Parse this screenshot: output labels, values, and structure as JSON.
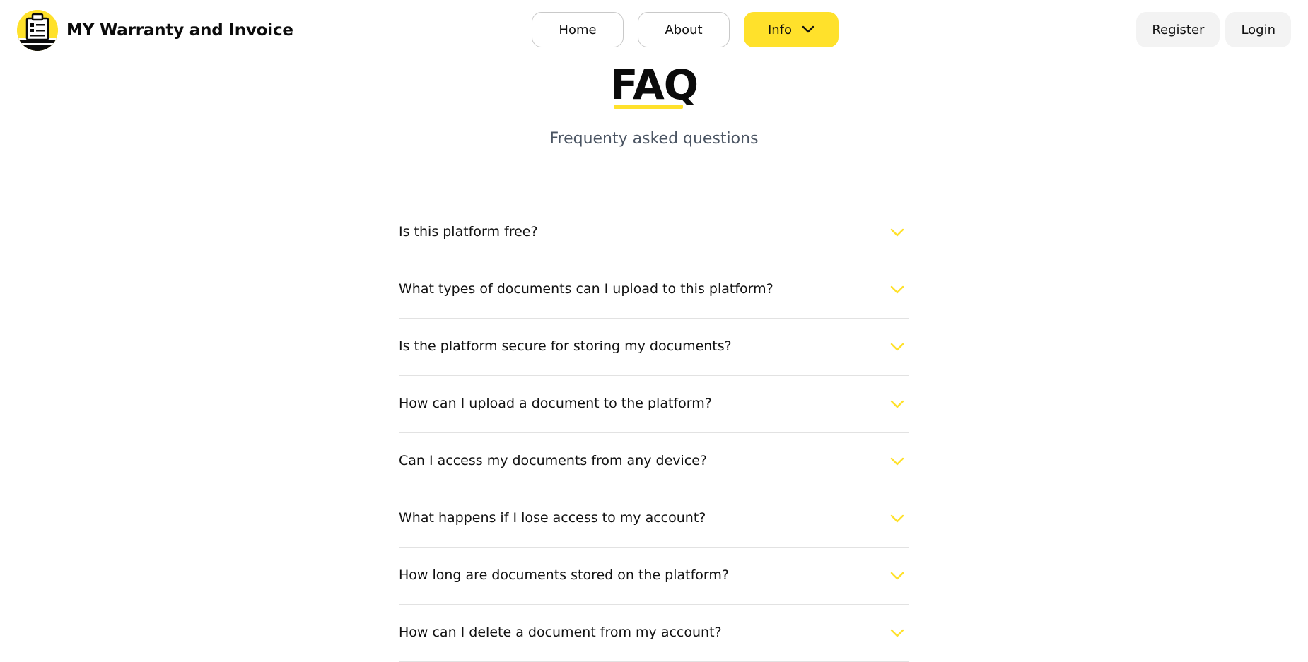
{
  "brand": {
    "name": "MY Warranty and Invoice",
    "logo_icon": "warranty-document-logo"
  },
  "nav": {
    "home": "Home",
    "about": "About",
    "info": "Info",
    "info_icon": "chevron-down-icon"
  },
  "auth": {
    "register": "Register",
    "login": "Login"
  },
  "faq": {
    "title": "FAQ",
    "subtitle": "Frequenty asked questions",
    "items": [
      {
        "question": "Is this platform free?"
      },
      {
        "question": "What types of documents can I upload to this platform?"
      },
      {
        "question": "Is the platform secure for storing my documents?"
      },
      {
        "question": "How can I upload a document to the platform?"
      },
      {
        "question": "Can I access my documents from any device?"
      },
      {
        "question": "What happens if I lose access to my account?"
      },
      {
        "question": "How long are documents stored on the platform?"
      },
      {
        "question": "How can I delete a document from my account?"
      }
    ]
  },
  "colors": {
    "accent": "#FFE12B",
    "text": "#111111",
    "muted": "#4B5563",
    "divider": "#E2E2E2",
    "auth_bg": "#F3F3F3"
  }
}
